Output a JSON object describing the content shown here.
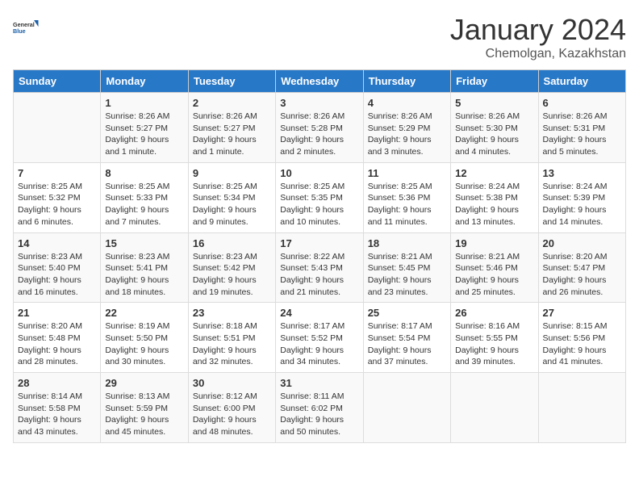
{
  "header": {
    "logo_line1": "General",
    "logo_line2": "Blue",
    "month": "January 2024",
    "location": "Chemolgan, Kazakhstan"
  },
  "weekdays": [
    "Sunday",
    "Monday",
    "Tuesday",
    "Wednesday",
    "Thursday",
    "Friday",
    "Saturday"
  ],
  "weeks": [
    [
      {
        "day": "",
        "info": ""
      },
      {
        "day": "1",
        "info": "Sunrise: 8:26 AM\nSunset: 5:27 PM\nDaylight: 9 hours\nand 1 minute."
      },
      {
        "day": "2",
        "info": "Sunrise: 8:26 AM\nSunset: 5:27 PM\nDaylight: 9 hours\nand 1 minute."
      },
      {
        "day": "3",
        "info": "Sunrise: 8:26 AM\nSunset: 5:28 PM\nDaylight: 9 hours\nand 2 minutes."
      },
      {
        "day": "4",
        "info": "Sunrise: 8:26 AM\nSunset: 5:29 PM\nDaylight: 9 hours\nand 3 minutes."
      },
      {
        "day": "5",
        "info": "Sunrise: 8:26 AM\nSunset: 5:30 PM\nDaylight: 9 hours\nand 4 minutes."
      },
      {
        "day": "6",
        "info": "Sunrise: 8:26 AM\nSunset: 5:31 PM\nDaylight: 9 hours\nand 5 minutes."
      }
    ],
    [
      {
        "day": "7",
        "info": "Sunrise: 8:25 AM\nSunset: 5:32 PM\nDaylight: 9 hours\nand 6 minutes."
      },
      {
        "day": "8",
        "info": "Sunrise: 8:25 AM\nSunset: 5:33 PM\nDaylight: 9 hours\nand 7 minutes."
      },
      {
        "day": "9",
        "info": "Sunrise: 8:25 AM\nSunset: 5:34 PM\nDaylight: 9 hours\nand 9 minutes."
      },
      {
        "day": "10",
        "info": "Sunrise: 8:25 AM\nSunset: 5:35 PM\nDaylight: 9 hours\nand 10 minutes."
      },
      {
        "day": "11",
        "info": "Sunrise: 8:25 AM\nSunset: 5:36 PM\nDaylight: 9 hours\nand 11 minutes."
      },
      {
        "day": "12",
        "info": "Sunrise: 8:24 AM\nSunset: 5:38 PM\nDaylight: 9 hours\nand 13 minutes."
      },
      {
        "day": "13",
        "info": "Sunrise: 8:24 AM\nSunset: 5:39 PM\nDaylight: 9 hours\nand 14 minutes."
      }
    ],
    [
      {
        "day": "14",
        "info": "Sunrise: 8:23 AM\nSunset: 5:40 PM\nDaylight: 9 hours\nand 16 minutes."
      },
      {
        "day": "15",
        "info": "Sunrise: 8:23 AM\nSunset: 5:41 PM\nDaylight: 9 hours\nand 18 minutes."
      },
      {
        "day": "16",
        "info": "Sunrise: 8:23 AM\nSunset: 5:42 PM\nDaylight: 9 hours\nand 19 minutes."
      },
      {
        "day": "17",
        "info": "Sunrise: 8:22 AM\nSunset: 5:43 PM\nDaylight: 9 hours\nand 21 minutes."
      },
      {
        "day": "18",
        "info": "Sunrise: 8:21 AM\nSunset: 5:45 PM\nDaylight: 9 hours\nand 23 minutes."
      },
      {
        "day": "19",
        "info": "Sunrise: 8:21 AM\nSunset: 5:46 PM\nDaylight: 9 hours\nand 25 minutes."
      },
      {
        "day": "20",
        "info": "Sunrise: 8:20 AM\nSunset: 5:47 PM\nDaylight: 9 hours\nand 26 minutes."
      }
    ],
    [
      {
        "day": "21",
        "info": "Sunrise: 8:20 AM\nSunset: 5:48 PM\nDaylight: 9 hours\nand 28 minutes."
      },
      {
        "day": "22",
        "info": "Sunrise: 8:19 AM\nSunset: 5:50 PM\nDaylight: 9 hours\nand 30 minutes."
      },
      {
        "day": "23",
        "info": "Sunrise: 8:18 AM\nSunset: 5:51 PM\nDaylight: 9 hours\nand 32 minutes."
      },
      {
        "day": "24",
        "info": "Sunrise: 8:17 AM\nSunset: 5:52 PM\nDaylight: 9 hours\nand 34 minutes."
      },
      {
        "day": "25",
        "info": "Sunrise: 8:17 AM\nSunset: 5:54 PM\nDaylight: 9 hours\nand 37 minutes."
      },
      {
        "day": "26",
        "info": "Sunrise: 8:16 AM\nSunset: 5:55 PM\nDaylight: 9 hours\nand 39 minutes."
      },
      {
        "day": "27",
        "info": "Sunrise: 8:15 AM\nSunset: 5:56 PM\nDaylight: 9 hours\nand 41 minutes."
      }
    ],
    [
      {
        "day": "28",
        "info": "Sunrise: 8:14 AM\nSunset: 5:58 PM\nDaylight: 9 hours\nand 43 minutes."
      },
      {
        "day": "29",
        "info": "Sunrise: 8:13 AM\nSunset: 5:59 PM\nDaylight: 9 hours\nand 45 minutes."
      },
      {
        "day": "30",
        "info": "Sunrise: 8:12 AM\nSunset: 6:00 PM\nDaylight: 9 hours\nand 48 minutes."
      },
      {
        "day": "31",
        "info": "Sunrise: 8:11 AM\nSunset: 6:02 PM\nDaylight: 9 hours\nand 50 minutes."
      },
      {
        "day": "",
        "info": ""
      },
      {
        "day": "",
        "info": ""
      },
      {
        "day": "",
        "info": ""
      }
    ]
  ]
}
